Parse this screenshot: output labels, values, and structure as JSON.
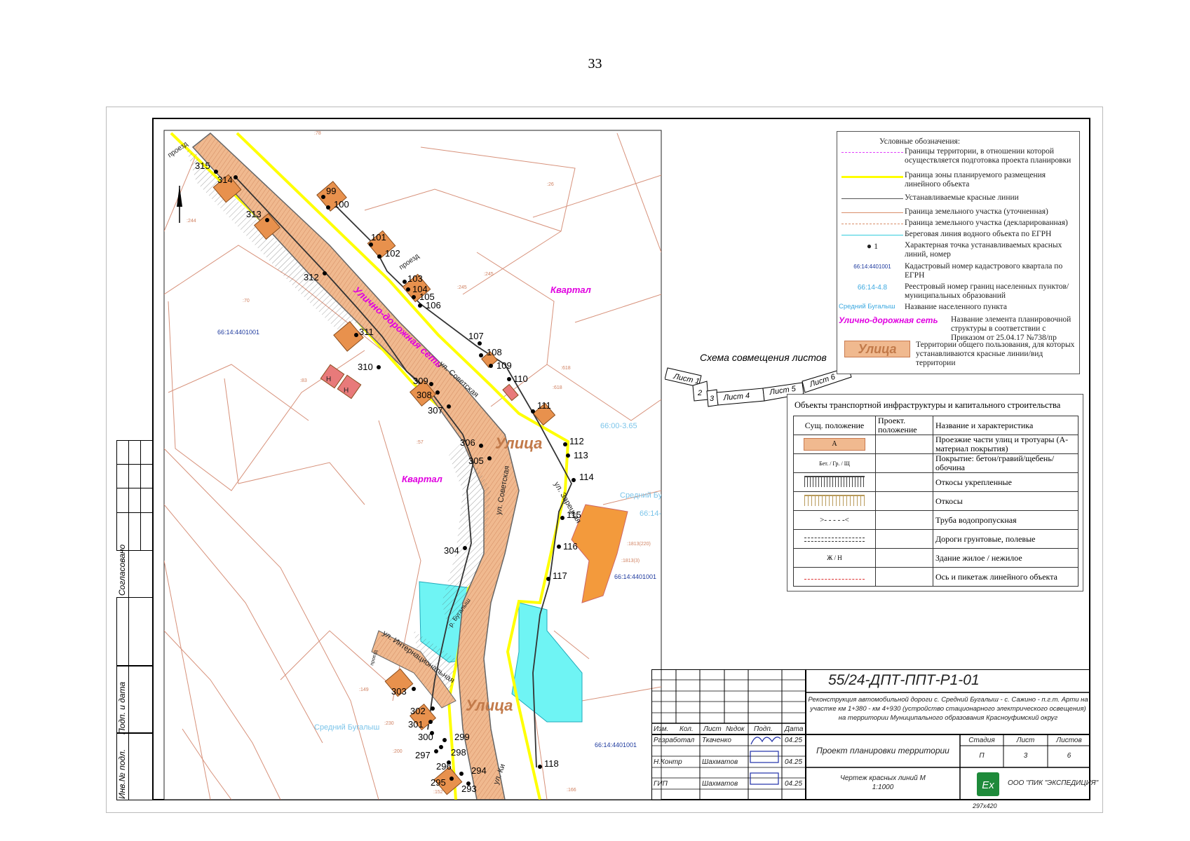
{
  "page_number": "33",
  "map": {
    "red_line_points": [
      "315",
      "314",
      "313",
      "312",
      "311",
      "310",
      "309",
      "308",
      "307",
      "306",
      "305",
      "304",
      "303",
      "302",
      "301",
      "300",
      "299",
      "298",
      "297",
      "296",
      "295",
      "294",
      "293",
      "99",
      "100",
      "101",
      "102",
      "103",
      "104",
      "105",
      "106",
      "107",
      "108",
      "109",
      "110",
      "111",
      "112",
      "113",
      "114",
      "115",
      "116",
      "117",
      "118"
    ],
    "cadastre": [
      "66:14:4401001",
      "66:14:4401001",
      "66:14:4401001",
      "66:00-3.65",
      "66:14-"
    ],
    "parcels": [
      ":244",
      ":70",
      ":83",
      ":57",
      ":26",
      ":245",
      ":245",
      ":618",
      ":618",
      ":1813(220)",
      ":1813(3)",
      ":149",
      ":200",
      ":152",
      ":166",
      ":230",
      ":78"
    ],
    "places": [
      "Квартал",
      "Квартал"
    ],
    "streets": [
      "ул. Советская",
      "ул. Советская",
      "ул. Зарецкая",
      "ул. Интернациональная",
      "ул. Ки"
    ],
    "section_labels": [
      "Улично-дорожная сеть",
      "Улица",
      "Улица"
    ],
    "river": "р. Бугалыш",
    "settlement": "Средний Бугалыш",
    "settlement_partial": "Средний Бу",
    "driveways": [
      "проезд",
      "проезд",
      "проезд"
    ],
    "building_codes": [
      "Н",
      "Н"
    ]
  },
  "schema": {
    "title": "Схема совмещения листов",
    "sheets": [
      "Лист 1",
      "2",
      "3",
      "Лист 4",
      "Лист 5",
      "Лист 6"
    ]
  },
  "legend": {
    "title": "Условные обозначения:",
    "items": [
      {
        "text": "Границы территории, в отношении которой осуществляется подготовка проекта планировки",
        "color": "#e040fb"
      },
      {
        "text": "Граница зоны планируемого размещения линейного объекта",
        "color": "#ffff00"
      },
      {
        "text": "Устанавливаемые красные линии",
        "color": "#555555"
      },
      {
        "text": "Граница земельного участка (уточненная)",
        "color": "#d98e6a"
      },
      {
        "text": "Граница земельного участка (декларированная)",
        "color": "#d98e6a"
      },
      {
        "text": "Береговая линия водного объекта по ЕГРН",
        "color": "#33ccdd"
      },
      {
        "text": "Характерная точка устанавливаемых красных линий, номер",
        "sym": "1"
      },
      {
        "text": "Кадастровый номер кадастрового квартала по ЕГРН",
        "sym": "66:14:4401001"
      },
      {
        "text": "Реестровый номер границ населенных пунктов/муниципальных образований",
        "sym": "66:14-4.8"
      },
      {
        "text": "Название населенного пункта",
        "sym": "Средний Бугалыш"
      },
      {
        "text": "Название элемента планировочной структуры в соответствии с Приказом от 25.04.17 №738/пр",
        "sym": "Улично-дорожная сеть"
      },
      {
        "text": "Территории общего пользования, для которых устанавливаются красные линии/вид территории",
        "sym": "Улица"
      }
    ]
  },
  "objects": {
    "title": "Объекты транспортной инфраструктуры и капитального строительства",
    "headers": [
      "Сущ. положение",
      "Проект. положение",
      "Название и характеристика"
    ],
    "rows": [
      {
        "sym": "A",
        "name": "Проезжие части улиц и тротуары (А-материал покрытия)"
      },
      {
        "sym": "Бет. / Гр. / Щ",
        "name": "Покрытие: бетон/гравий/щебень/обочина"
      },
      {
        "sym": "",
        "name": "Откосы укрепленные"
      },
      {
        "sym": "",
        "name": "Откосы"
      },
      {
        "sym": "",
        "name": "Труба водопропускная"
      },
      {
        "sym": "",
        "name": "Дороги грунтовые, полевые"
      },
      {
        "sym": "Ж / Н",
        "name": "Здание жилое / нежилое"
      },
      {
        "sym": "",
        "name": "Ось и пикетаж линейного объекта"
      }
    ]
  },
  "stamp": {
    "code": "55/24-ДПТ-ППТ-Р1-01",
    "description": "Реконструкция автомобильной дороги с. Средний Бугалыш - с. Сажино - п.г.т. Арти на участке км 1+380 - км 4+930 (устройство стационарного электрического освещения) на территории Муниципального образования Красноуфимский округ",
    "col_headers": [
      "Изм.",
      "Кол.",
      "Лист",
      "№док",
      "Подп.",
      "Дата"
    ],
    "people": [
      {
        "role": "Разработал",
        "name": "Ткаченко",
        "date": "04.25"
      },
      {
        "role": "Н.Контр",
        "name": "Шахматов",
        "date": "04.25"
      },
      {
        "role": "ГИП",
        "name": "Шахматов",
        "date": "04.25"
      }
    ],
    "doc_title": "Проект планировки территории",
    "stage_headers": [
      "Стадия",
      "Лист",
      "Листов"
    ],
    "stage_values": [
      "П",
      "3",
      "6"
    ],
    "drawing_title": "Чертеж красных линий М 1:1000",
    "company": "ООО \"ПИК \"ЭКСПЕДИЦИЯ\"",
    "logo": "Ex",
    "format": "297х420"
  },
  "side_labels": [
    "Согласовано",
    "Подп. и дата",
    "Инв.№ подл."
  ]
}
